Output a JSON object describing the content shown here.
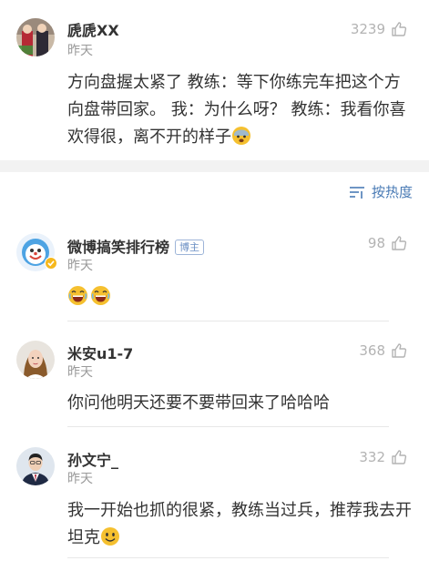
{
  "main_post": {
    "username": "虒虒XX",
    "time": "昨天",
    "likes": "3239",
    "content": "方向盘握太紧了 教练：等下你练完车把这个方向盘带回家。 我：为什么呀？ 教练：我看你喜欢得很，离不开的样子",
    "emoji": "fearful-face-emoji"
  },
  "sort": {
    "label": "按热度",
    "icon": "sort-icon"
  },
  "comments": [
    {
      "username": "微博搞笑排行榜",
      "badge": "博主",
      "time": "昨天",
      "likes": "98",
      "content": "",
      "emojis": [
        "laughing-emoji",
        "laughing-emoji"
      ]
    },
    {
      "username": "米安u1-7",
      "time": "昨天",
      "likes": "368",
      "content": "你问他明天还要不要带回来了哈哈哈"
    },
    {
      "username": "孙文宁_",
      "time": "昨天",
      "likes": "332",
      "content": "我一开始也抓的很紧，教练当过兵，推荐我去开坦克",
      "emoji": "smile-emoji"
    }
  ],
  "colors": {
    "link": "#4a7bb5",
    "muted": "#9a9a9a",
    "separator": "#f2f2f2",
    "emoji_yellow": "#f5c02f"
  }
}
